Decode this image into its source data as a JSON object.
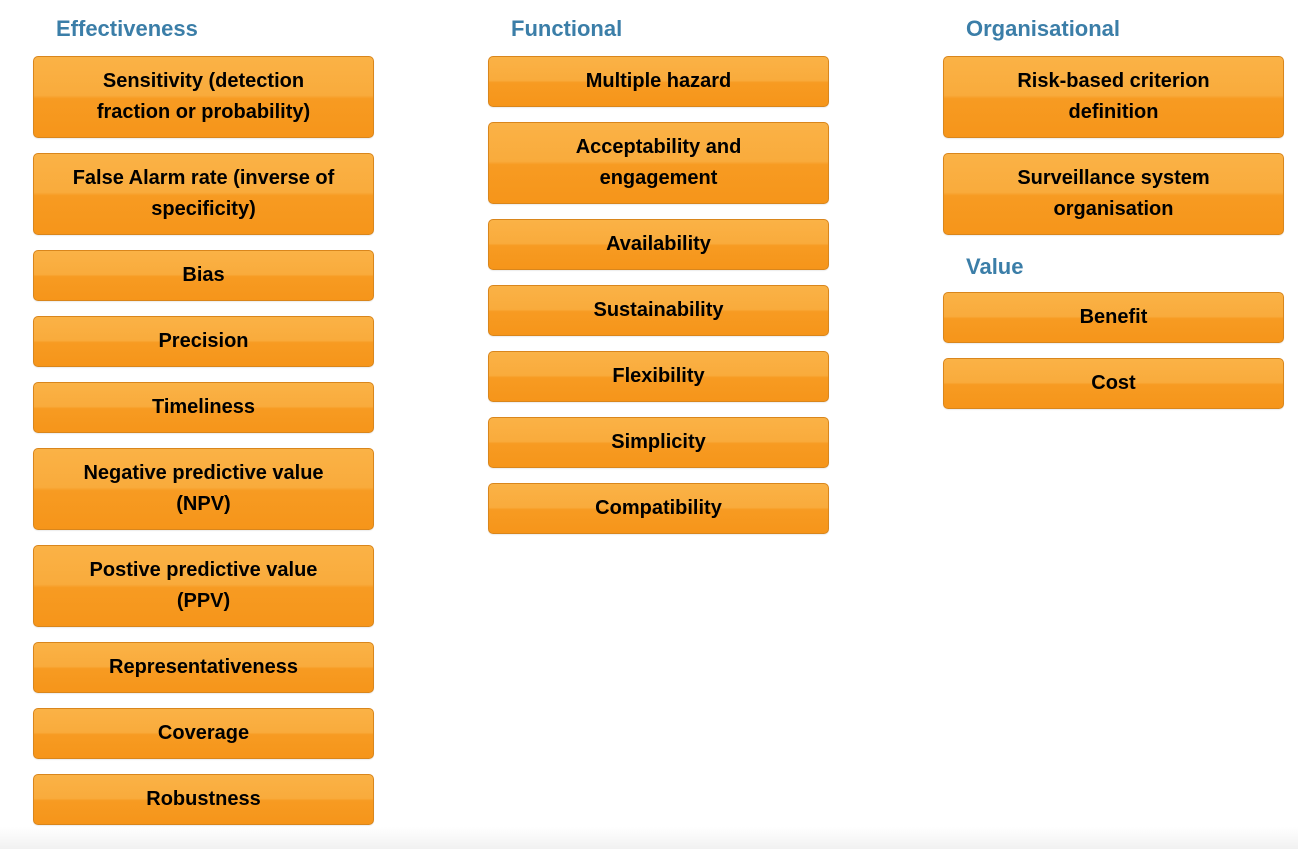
{
  "columns": [
    {
      "groups": [
        {
          "heading": "Effectiveness",
          "items": [
            {
              "lines": [
                "Sensitivity (detection",
                "fraction or probability)"
              ]
            },
            {
              "lines": [
                "False Alarm rate (inverse of",
                "specificity)"
              ]
            },
            {
              "lines": [
                "Bias"
              ]
            },
            {
              "lines": [
                "Precision"
              ]
            },
            {
              "lines": [
                "Timeliness"
              ]
            },
            {
              "lines": [
                "Negative predictive value",
                "(NPV)"
              ]
            },
            {
              "lines": [
                "Postive predictive value",
                "(PPV)"
              ]
            },
            {
              "lines": [
                "Representativeness"
              ]
            },
            {
              "lines": [
                "Coverage"
              ]
            },
            {
              "lines": [
                "Robustness"
              ]
            }
          ]
        }
      ]
    },
    {
      "groups": [
        {
          "heading": "Functional",
          "items": [
            {
              "lines": [
                "Multiple hazard"
              ]
            },
            {
              "lines": [
                "Acceptability and",
                "engagement"
              ]
            },
            {
              "lines": [
                "Availability"
              ]
            },
            {
              "lines": [
                "Sustainability"
              ]
            },
            {
              "lines": [
                "Flexibility"
              ]
            },
            {
              "lines": [
                "Simplicity"
              ]
            },
            {
              "lines": [
                "Compatibility"
              ]
            }
          ]
        }
      ]
    },
    {
      "groups": [
        {
          "heading": "Organisational",
          "items": [
            {
              "lines": [
                "Risk-based criterion",
                "definition"
              ]
            },
            {
              "lines": [
                "Surveillance system",
                "organisation"
              ]
            }
          ]
        },
        {
          "heading": "Value",
          "items": [
            {
              "lines": [
                "Benefit"
              ]
            },
            {
              "lines": [
                "Cost"
              ]
            }
          ]
        }
      ]
    }
  ],
  "colors": {
    "heading": "#3b7ea8",
    "box_top": "#fab246",
    "box_bottom": "#f6951a",
    "box_border": "#d9861c"
  }
}
